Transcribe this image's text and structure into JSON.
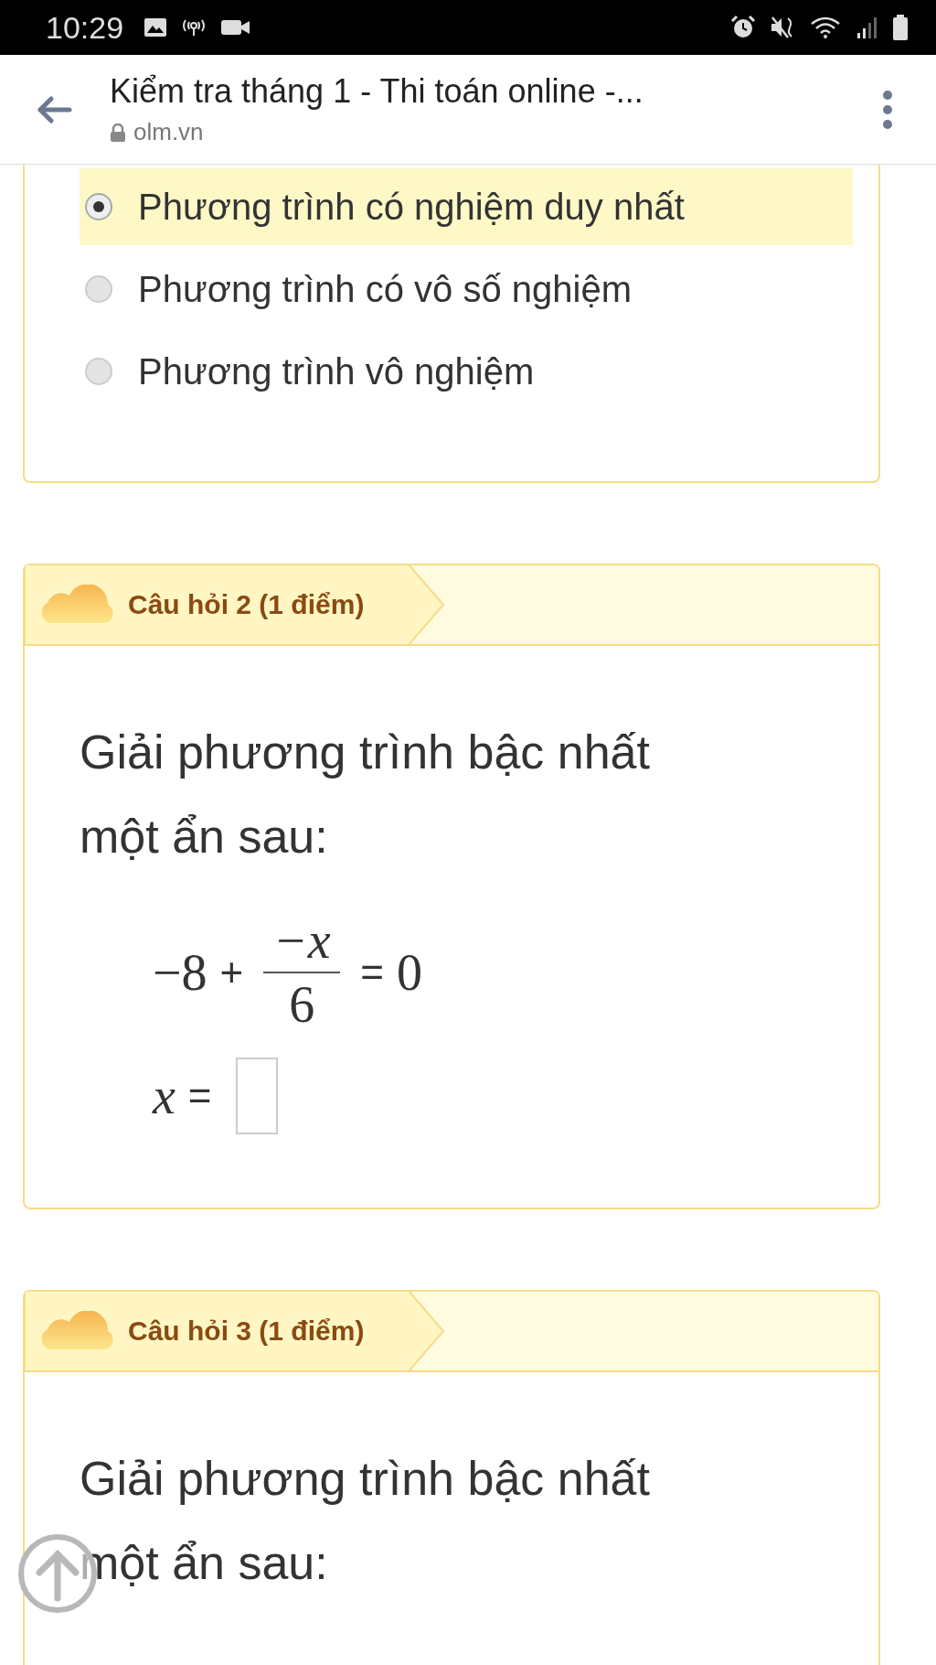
{
  "status_bar": {
    "time": "10:29"
  },
  "browser": {
    "title": "Kiểm tra tháng 1 - Thi toán online -...",
    "url": "olm.vn"
  },
  "question_1": {
    "options": [
      {
        "label": "Phương trình có nghiệm duy nhất",
        "selected": true
      },
      {
        "label": "Phương trình có vô số nghiệm",
        "selected": false
      },
      {
        "label": "Phương trình vô nghiệm",
        "selected": false
      }
    ]
  },
  "question_2": {
    "title": "Câu hỏi 2 (1 điểm)",
    "text": "Giải phương trình bậc nhất một ẩn sau:",
    "equation": {
      "constant": "−8",
      "plus": "+",
      "numerator": "−x",
      "denominator": "6",
      "equals": "=",
      "result": "0"
    },
    "answer": {
      "variable": "x",
      "equals": "="
    }
  },
  "question_3": {
    "title": "Câu hỏi 3 (1 điểm)",
    "text": "Giải phương trình bậc nhất một ẩn sau:"
  }
}
